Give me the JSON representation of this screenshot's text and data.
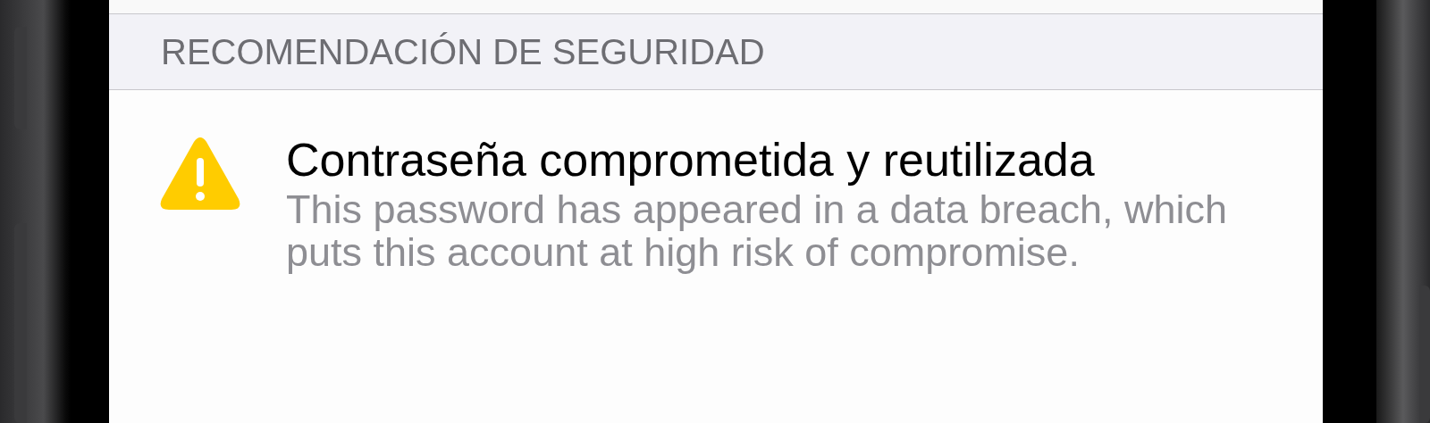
{
  "section_header": "RECOMENDACIÓN DE SEGURIDAD",
  "alert": {
    "title": "Contraseña comprometida y reutilizada",
    "description": "This password has appeared in a data breach, which puts this account at high risk of compromise."
  }
}
